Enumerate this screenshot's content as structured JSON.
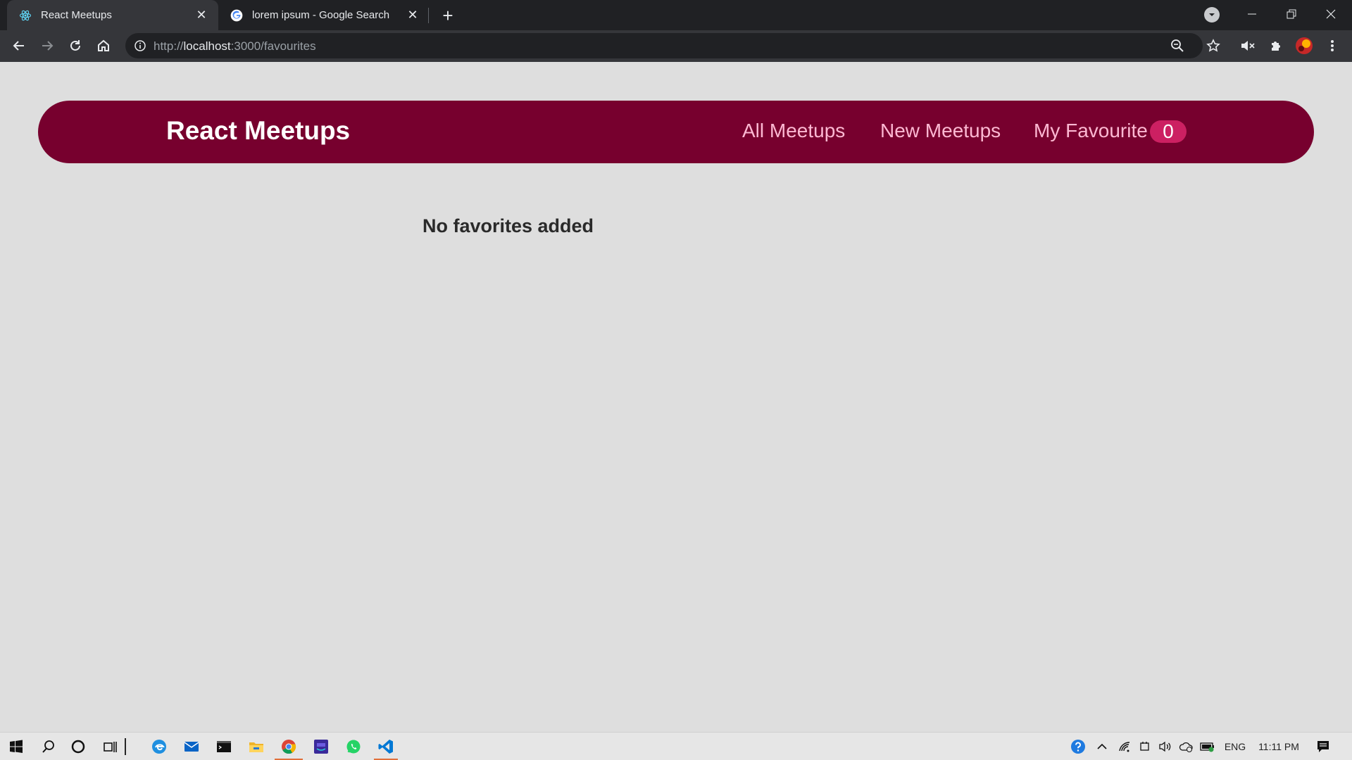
{
  "browser": {
    "tabs": [
      {
        "title": "React Meetups",
        "icon": "react-icon",
        "active": true
      },
      {
        "title": "lorem ipsum - Google Search",
        "icon": "google-icon",
        "active": false
      }
    ],
    "url_scheme": "http://",
    "url_host": "localhost",
    "url_path": ":3000/favourites"
  },
  "navbar": {
    "brand": "React Meetups",
    "links": [
      "All Meetups",
      "New Meetups",
      "My Favourite"
    ],
    "favourite_count": "0"
  },
  "main": {
    "empty_message": "No favorites added"
  },
  "taskbar": {
    "language": "ENG",
    "time": "11:11 PM"
  },
  "colors": {
    "navbar_bg": "#77002e",
    "nav_link": "#fcb8d2",
    "badge_bg": "#cc2062",
    "page_bg": "#dedede"
  }
}
